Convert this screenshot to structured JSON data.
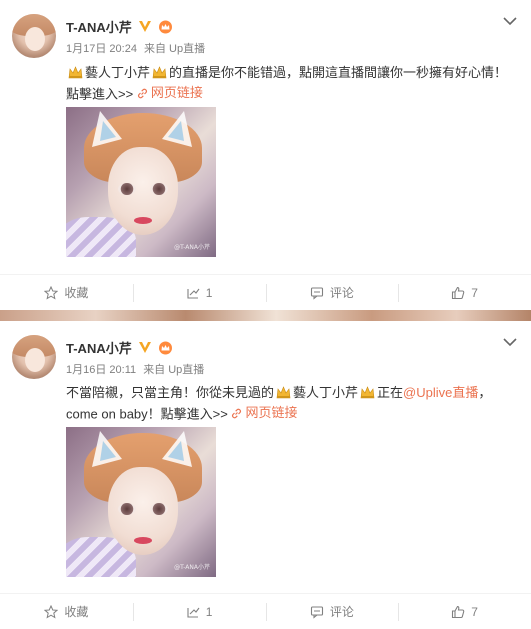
{
  "posts": [
    {
      "user_name": "T-ANA小芹",
      "date": "1月17日 20:24",
      "source": "来自 Up直播",
      "text_line1_a": "藝人丁小芹",
      "text_line1_b": "的直播是你不能错過，點開這直播間讓你一秒擁有好心情！",
      "text_line2": "點擊進入>>",
      "web_link": "网页链接",
      "watermark": "@T-ANA小芹",
      "actions": {
        "favorite": "收藏",
        "repost": "1",
        "comment": "评论",
        "like": "7"
      }
    },
    {
      "user_name": "T-ANA小芹",
      "date": "1月16日 20:11",
      "source": "来自 Up直播",
      "text_line1_a": "不當陪襯，只當主角！你從未見過的",
      "text_line1_b": "藝人丁小芹",
      "text_line1_c": "正在",
      "mention": "@Uplive直播",
      "text_line1_d": "，",
      "text_line2": "come on baby！點擊進入>>",
      "web_link": "网页链接",
      "watermark": "@T-ANA小芹",
      "actions": {
        "favorite": "收藏",
        "repost": "1",
        "comment": "评论",
        "like": "7"
      }
    }
  ],
  "icons": {
    "verified": "verified-v-icon",
    "crown": "crown-badge-icon",
    "chevron": "chevron-down-icon",
    "link": "link-icon",
    "favorite": "star-icon",
    "repost": "repost-icon",
    "comment": "comment-icon",
    "like": "thumbs-up-icon"
  },
  "colors": {
    "link": "#eb7350",
    "verified": "#f5a623",
    "meta": "#808080"
  }
}
